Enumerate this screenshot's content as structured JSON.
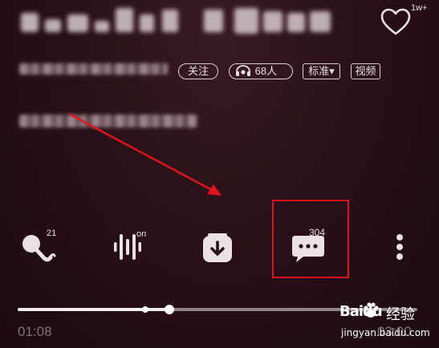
{
  "header": {
    "like_count": "1w+"
  },
  "meta": {
    "follow_label": "关注",
    "listeners_count": "68人",
    "quality_label": "标准▾",
    "video_label": "视频"
  },
  "controls": {
    "karaoke_count": "21",
    "effect_state": "on",
    "comment_count": "304"
  },
  "player": {
    "progress": 0.38,
    "buffered": 0.32,
    "elapsed": "01:08",
    "total": "03:00"
  },
  "watermark": {
    "brand": "Baidu",
    "brand_cn": "经验",
    "url": "jingyan.baidu.com"
  },
  "colors": {
    "highlight": "#e0141c",
    "arrow": "#e0141c"
  }
}
